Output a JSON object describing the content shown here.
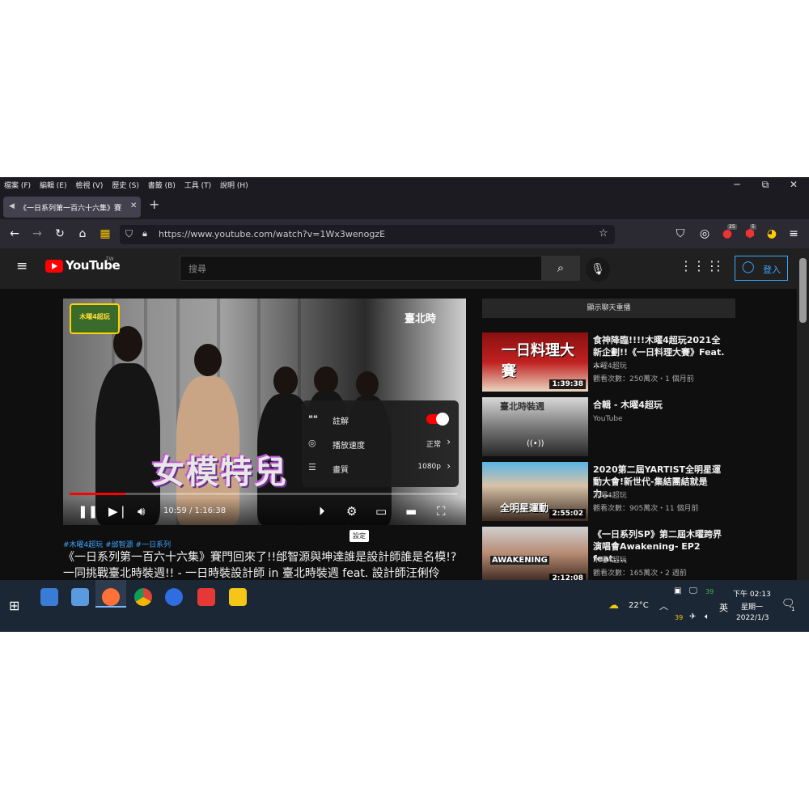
{
  "menubar": {
    "items": [
      "檔案 (F)",
      "編輯 (E)",
      "檢視 (V)",
      "歷史 (S)",
      "書籤 (B)",
      "工具 (T)",
      "說明 (H)"
    ],
    "minimize": "─",
    "restore": "⧉",
    "close": "✕"
  },
  "tab": {
    "title": "《一日系列第一百六十六集》賽",
    "close": "✕",
    "new_tab": "+"
  },
  "nav": {
    "url": "https://www.youtube.com/watch?v=1Wx3wenogzE",
    "ext_badges": [
      "25",
      "5"
    ]
  },
  "youtube": {
    "logo": "YouTube",
    "region": "TW",
    "search_placeholder": "搜尋",
    "signin": "登入"
  },
  "player": {
    "overlay_text": "女模特兒",
    "channel_watermark": "木曜4超玩",
    "brand_watermark": "臺北時",
    "time": "10:59 / 1:16:38",
    "progress_fraction": 0.143,
    "tooltip": "設定",
    "settings": {
      "subtitles_label": "註解",
      "speed_label": "播放速度",
      "speed_value": "正常",
      "quality_label": "畫質",
      "quality_value": "1080p"
    }
  },
  "video": {
    "hashtags": "#木曜4超玩 #邰智源 #一日系列",
    "title": "《一日系列第一百六十六集》賽門回來了!!邰智源與坤達誰是設計師誰是名模!?一同挑戰臺北時裝週!! - 一日時裝設計師 in 臺北時裝週 feat. 設計師汪俐伶"
  },
  "sidebar": {
    "chat_replay": "顯示聊天重播",
    "items": [
      {
        "title": "食神降臨!!!!木曜4超玩2021全新企劃!!《一日料理大賽》Feat. ...",
        "channel": "木曜4超玩",
        "meta": "觀看次數：250萬次・1 個月前",
        "duration": "1:39:38",
        "thumb_text": "一日料理大賽"
      },
      {
        "title": "合輯 - 木曜4超玩",
        "channel": "YouTube",
        "meta": "",
        "duration": "",
        "thumb_text": "臺北時裝週"
      },
      {
        "title": "2020第二屆YARTIST全明星運動大會!新世代-集結團結就是力...",
        "channel": "木曜4超玩",
        "meta": "觀看次數：905萬次・11 個月前",
        "duration": "2:55:02",
        "thumb_text": "全明星運動"
      },
      {
        "title": "《一日系列SP》第二屆木曜跨界演唱會Awakening- EP2 feat....",
        "channel": "木曜4超玩",
        "meta": "觀看次數：165萬次・2 週前",
        "duration": "2:12:08",
        "thumb_text": "AWAKENING"
      }
    ]
  },
  "taskbar": {
    "weather": "22°C",
    "ime": "英",
    "time": "下午 02:13",
    "weekday": "星期一",
    "date": "2022/1/3",
    "tray_num1": "39",
    "tray_num2": "39",
    "notif_count": "1"
  }
}
